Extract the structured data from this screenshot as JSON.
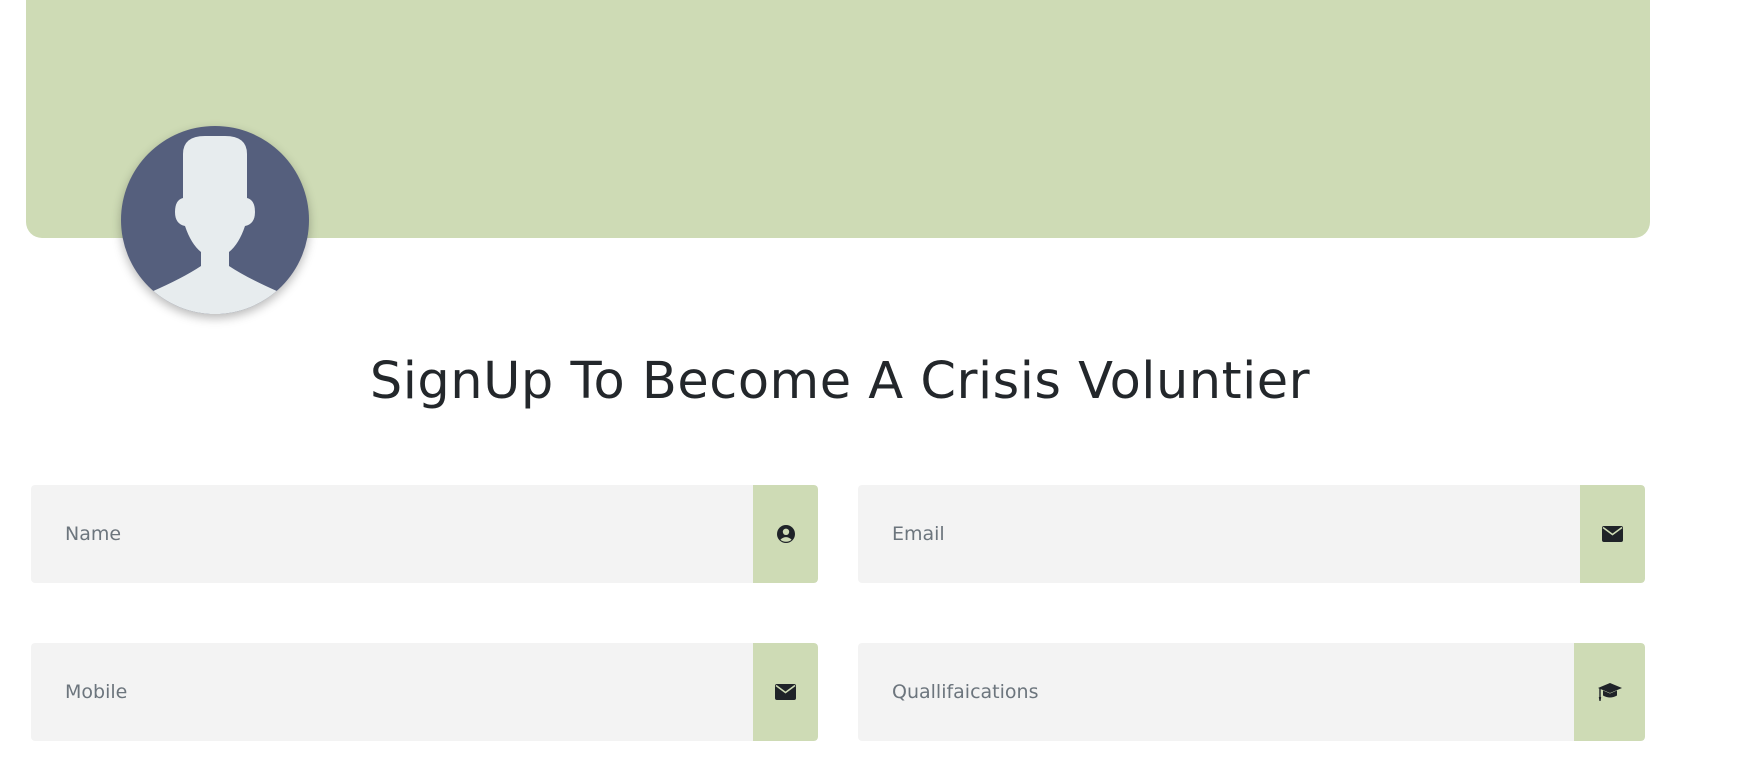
{
  "header": {
    "banner_color": "#cedbb5",
    "avatar_icon": "user-silhouette-icon"
  },
  "page_title": "SignUp To Become A Crisis Voluntier",
  "form": {
    "name": {
      "placeholder": "Name",
      "icon": "user-circle-icon"
    },
    "email": {
      "placeholder": "Email",
      "icon": "envelope-icon"
    },
    "mobile": {
      "placeholder": "Mobile",
      "icon": "envelope-icon"
    },
    "qualifications": {
      "placeholder": "Quallifaications",
      "icon": "graduation-cap-icon"
    }
  },
  "colors": {
    "accent": "#cedbb5",
    "avatar_bg": "#555f7d",
    "input_bg": "#f3f3f3",
    "title_text": "#23272b",
    "placeholder_text": "#6c757d"
  }
}
